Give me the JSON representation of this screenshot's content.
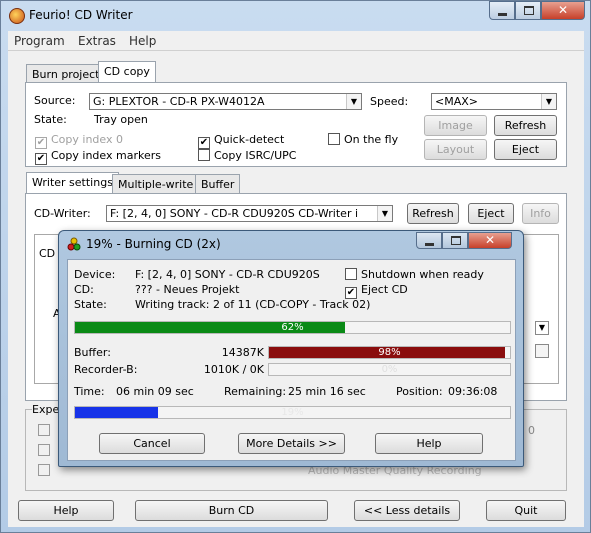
{
  "app": {
    "title": "Feurio! CD Writer",
    "menu": [
      "Program",
      "Extras",
      "Help"
    ]
  },
  "project_tabs": [
    "Burn project",
    "CD copy"
  ],
  "source": {
    "label": "Source:",
    "value": "G:  PLEXTOR - CD-R   PX-W4012A",
    "speed_label": "Speed:",
    "speed_value": "<MAX>",
    "state_label": "State:",
    "state_value": "Tray open",
    "copy_index0": "Copy index 0",
    "copy_index_markers": "Copy index markers",
    "quick_detect": "Quick-detect",
    "copy_isrc": "Copy ISRC/UPC",
    "on_the_fly": "On the fly",
    "image_button": "Image",
    "refresh_button": "Refresh",
    "layout_button": "Layout",
    "eject_button": "Eject"
  },
  "writer_tabs": [
    "Writer settings",
    "Multiple-write",
    "Buffer"
  ],
  "writer": {
    "label": "CD-Writer:",
    "value": "F:  [2, 4, 0]  SONY - CD-R   CDU920S  CD-Writer i",
    "refresh_button": "Refresh",
    "eject_button": "Eject",
    "info_button": "Info"
  },
  "background_fragments": {
    "cd_prefix": "CD",
    "a_prefix": "A",
    "expert_prefix": "Expe",
    "audio_master": "Audio Master Quality Recording",
    "more_hint": "0"
  },
  "bottom_buttons": {
    "help": "Help",
    "burn": "Burn CD",
    "less_details": "<< Less details",
    "quit": "Quit"
  },
  "dialog": {
    "title": "19% - Burning CD (2x)",
    "device_label": "Device:",
    "device_value": "F:  [2, 4, 0]  SONY - CD-R   CDU920S",
    "cd_label": "CD:",
    "cd_value": "??? - Neues Projekt",
    "state_label": "State:",
    "state_value": "Writing track: 2 of 11 (CD-COPY - Track 02)",
    "shutdown_label": "Shutdown when ready",
    "eject_cd_label": "Eject CD",
    "track_progress": 62,
    "track_progress_text": "62%",
    "buffer_label": "Buffer:",
    "buffer_value": "14387K",
    "buffer_progress": 98,
    "buffer_progress_text": "98%",
    "recorder_label": "Recorder-B:",
    "recorder_value": "1010K / 0K",
    "recorder_progress": 0,
    "recorder_progress_text": "0%",
    "time_label": "Time:",
    "time_value": "06 min 09 sec",
    "remaining_label": "Remaining:",
    "remaining_value": "25 min 16 sec",
    "position_label": "Position:",
    "position_value": "09:36:08",
    "total_progress": 19,
    "total_progress_text": "19%",
    "cancel_button": "Cancel",
    "more_details_button": "More Details >>",
    "help_button": "Help"
  },
  "colors": {
    "track_fill": "#0a8a16",
    "buffer_fill": "#8a0d0d",
    "total_fill": "#1733e8"
  }
}
